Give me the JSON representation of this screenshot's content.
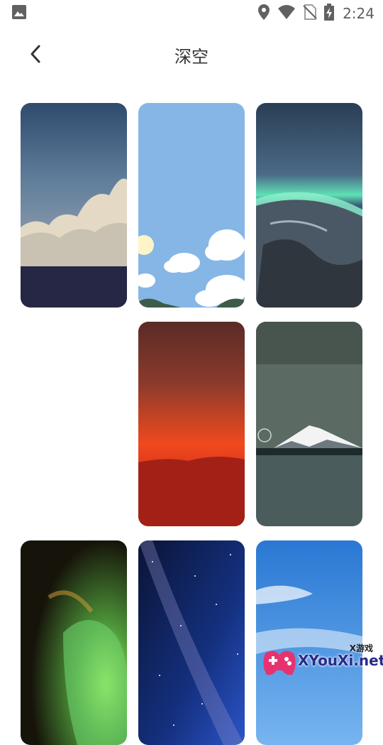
{
  "status_bar": {
    "time": "2:24",
    "icons": [
      "image-notification-icon",
      "location-icon",
      "wifi-icon",
      "no-sim-icon",
      "battery-charging-icon"
    ]
  },
  "header": {
    "title": "深空",
    "back_icon": "chevron-left-icon"
  },
  "wallpapers": [
    {
      "name": "clouds-dusk",
      "colors": [
        "#3d5a7d",
        "#6f8aa6",
        "#2b2f4e"
      ]
    },
    {
      "name": "cartoon-sky",
      "colors": [
        "#82b4e6",
        "#9cc6ee",
        "#ffffff"
      ]
    },
    {
      "name": "aurora-planet",
      "colors": [
        "#35506a",
        "#5de0b8",
        "#2a3340"
      ]
    },
    {
      "name": "empty",
      "colors": []
    },
    {
      "name": "red-desert",
      "colors": [
        "#5b2a24",
        "#f04a1e",
        "#9b1b12"
      ]
    },
    {
      "name": "snow-mountain-lake",
      "colors": [
        "#56665f",
        "#f1f1f1",
        "#1f2f33"
      ]
    },
    {
      "name": "nebula",
      "colors": [
        "#1a1808",
        "#4f9a3a",
        "#b4ff66"
      ]
    },
    {
      "name": "milky-way",
      "colors": [
        "#0b1640",
        "#1f3da0",
        "#c8c8ff"
      ]
    },
    {
      "name": "blue-sky",
      "colors": [
        "#2d7ad6",
        "#6aaef0",
        "#ffffff"
      ]
    }
  ],
  "watermark": {
    "small_text": "X游戏",
    "text": "XYouXi.net"
  }
}
